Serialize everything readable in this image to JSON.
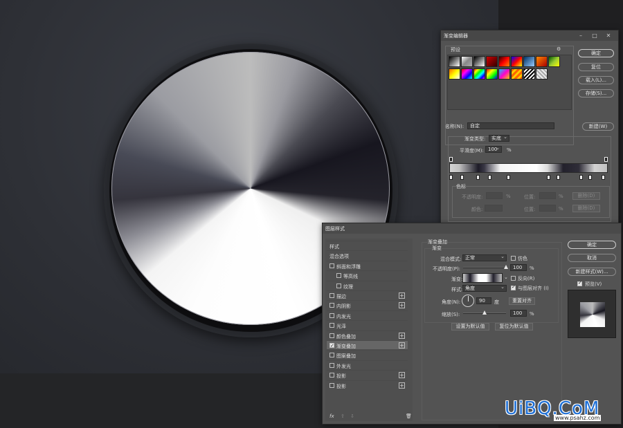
{
  "gradient_editor": {
    "title": "渐变编辑器",
    "presets_label": "预设",
    "buttons": {
      "ok": "确定",
      "reset": "复位",
      "load": "载入(L)...",
      "save": "存储(S)...",
      "new": "新建(W)"
    },
    "name_label": "名称(N):",
    "name_value": "自定",
    "type_label": "渐变类型:",
    "type_value": "实底",
    "smoothness_label": "平滑度(M):",
    "smoothness_value": "100",
    "smoothness_unit": "%",
    "color_stops_label": "色标",
    "opacity_label": "不透明度:",
    "location_label": "位置:",
    "color_label": "颜色:",
    "percent": "%",
    "delete_label": "删除(D)"
  },
  "layer_style": {
    "title": "图层样式",
    "sidebar": [
      {
        "label": "样式",
        "check": false,
        "plus": false,
        "indent": 0,
        "checked": false
      },
      {
        "label": "混合选项",
        "check": false,
        "plus": false,
        "indent": 0,
        "checked": false
      },
      {
        "label": "斜面和浮雕",
        "check": true,
        "plus": false,
        "indent": 0,
        "checked": false
      },
      {
        "label": "等高线",
        "check": true,
        "plus": false,
        "indent": 1,
        "checked": false
      },
      {
        "label": "纹理",
        "check": true,
        "plus": false,
        "indent": 1,
        "checked": false
      },
      {
        "label": "描边",
        "check": true,
        "plus": true,
        "indent": 0,
        "checked": false
      },
      {
        "label": "内阴影",
        "check": true,
        "plus": true,
        "indent": 0,
        "checked": false
      },
      {
        "label": "内发光",
        "check": true,
        "plus": false,
        "indent": 0,
        "checked": false
      },
      {
        "label": "光泽",
        "check": true,
        "plus": false,
        "indent": 0,
        "checked": false
      },
      {
        "label": "颜色叠加",
        "check": true,
        "plus": true,
        "indent": 0,
        "checked": false
      },
      {
        "label": "渐变叠加",
        "check": true,
        "plus": true,
        "indent": 0,
        "checked": true
      },
      {
        "label": "图案叠加",
        "check": true,
        "plus": false,
        "indent": 0,
        "checked": false
      },
      {
        "label": "外发光",
        "check": true,
        "plus": false,
        "indent": 0,
        "checked": false
      },
      {
        "label": "投影",
        "check": true,
        "plus": true,
        "indent": 0,
        "checked": false
      },
      {
        "label": "投影",
        "check": true,
        "plus": true,
        "indent": 0,
        "checked": false
      }
    ],
    "footer_fx": "fx",
    "section_title": "渐变叠加",
    "sub_title": "渐变",
    "blend_mode_label": "混合模式:",
    "blend_mode_value": "正常",
    "dither_label": "仿色",
    "opacity_label": "不透明度(P):",
    "opacity_value": "100",
    "opacity_level": 1.0,
    "gradient_label": "渐变:",
    "reverse_label": "反向(R)",
    "style_label": "样式:",
    "style_value": "角度",
    "align_label": "与图层对齐 (I)",
    "angle_label": "角度(N):",
    "angle_value": "90",
    "angle_unit": "度",
    "reset_align_label": "重置对齐",
    "scale_label": "缩放(S):",
    "scale_value": "100",
    "scale_level": 0.5,
    "percent": "%",
    "set_default": "设置为默认值",
    "reset_default": "复位为默认值",
    "buttons": {
      "ok": "确定",
      "cancel": "取消",
      "new_style": "新建样式(W)...",
      "preview": "预览(V)"
    }
  },
  "watermark": {
    "main": "UiBQ.CoM",
    "sub": "www.psahz.com"
  }
}
